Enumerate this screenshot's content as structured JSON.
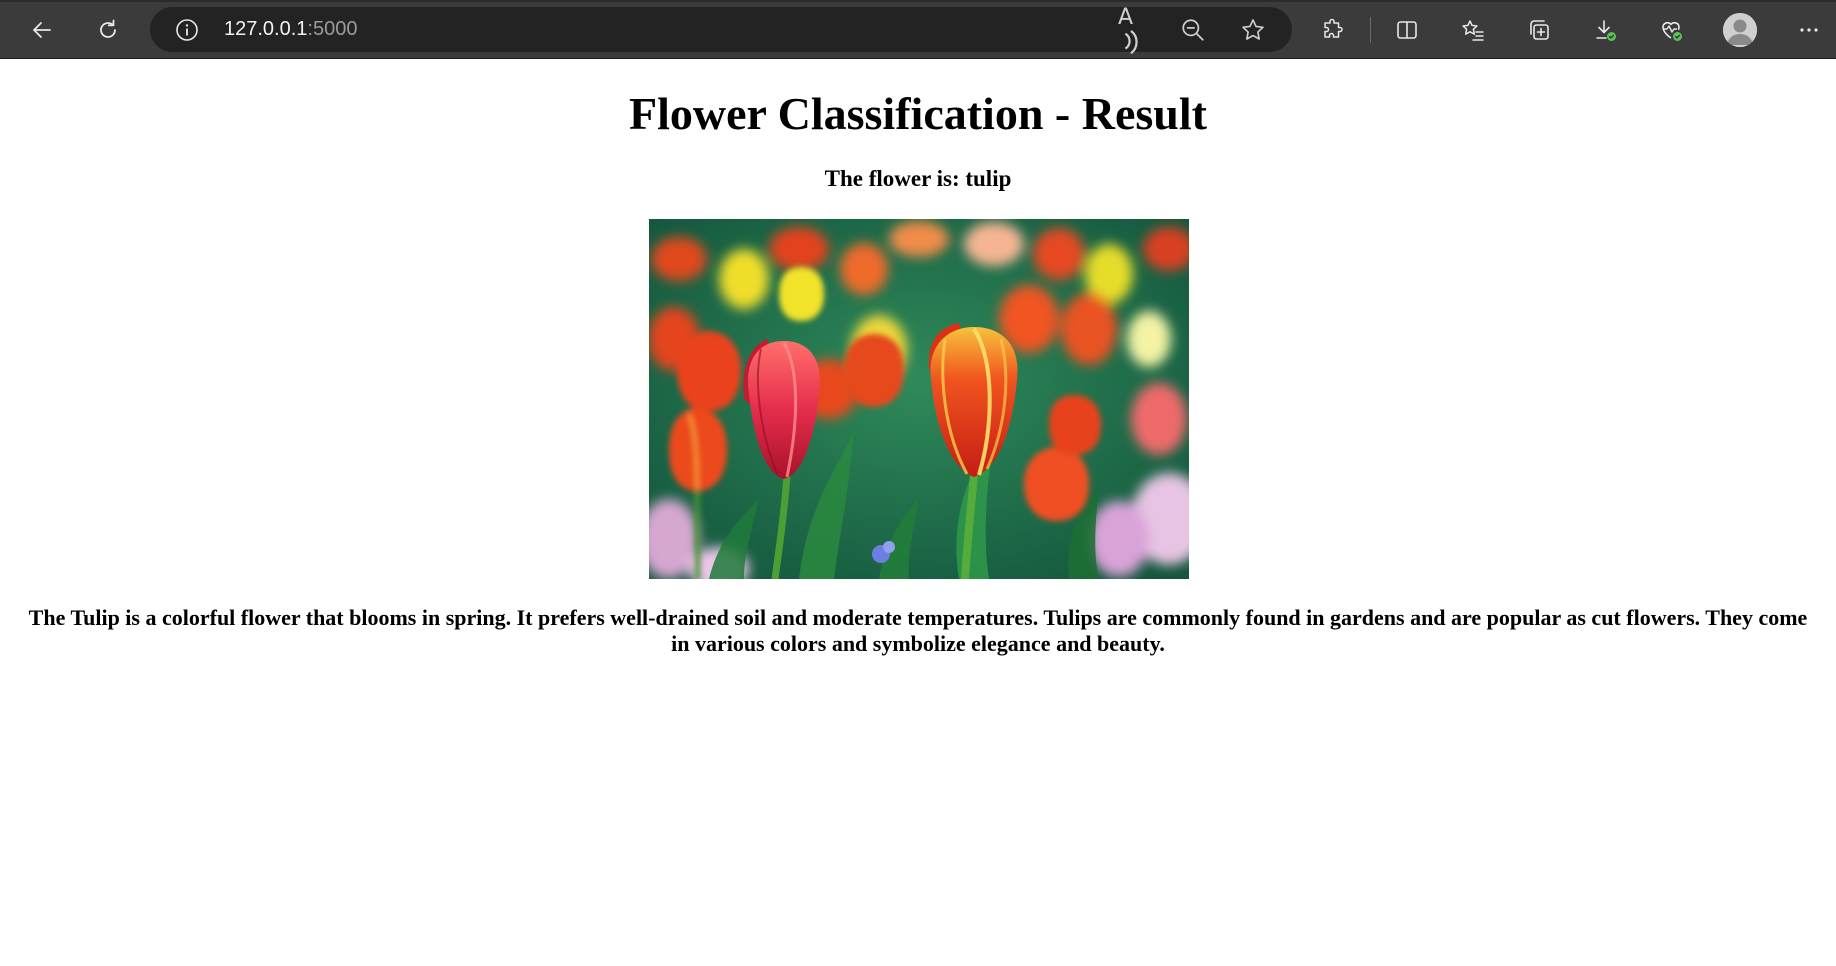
{
  "browser": {
    "url_host": "127.0.0.1",
    "url_port": ":5000",
    "read_aloud_label": "A",
    "icons": {
      "back": "back-arrow-icon",
      "refresh": "refresh-icon",
      "site_info": "info-icon",
      "read_aloud": "read-aloud-icon",
      "zoom_out": "zoom-out-icon",
      "favorite": "star-icon",
      "extensions": "puzzle-icon",
      "split_screen": "split-screen-icon",
      "favorites": "favorites-list-icon",
      "collections": "collections-icon",
      "downloads": "download-icon",
      "browser_essentials": "heart-pulse-icon",
      "profile": "avatar",
      "more": "ellipsis-icon"
    },
    "colors": {
      "toolbar": "#3b3b3b",
      "address_bar": "#232323",
      "success_badge": "#5fbf5f"
    }
  },
  "page": {
    "title": "Flower Classification - Result",
    "result_text": "The flower is: tulip",
    "image_alt": "tulip",
    "description": "The Tulip is a colorful flower that blooms in spring. It prefers well-drained soil and moderate temperatures. Tulips are commonly found in gardens and are popular as cut flowers. They come in various colors and symbolize elegance and beauty."
  }
}
